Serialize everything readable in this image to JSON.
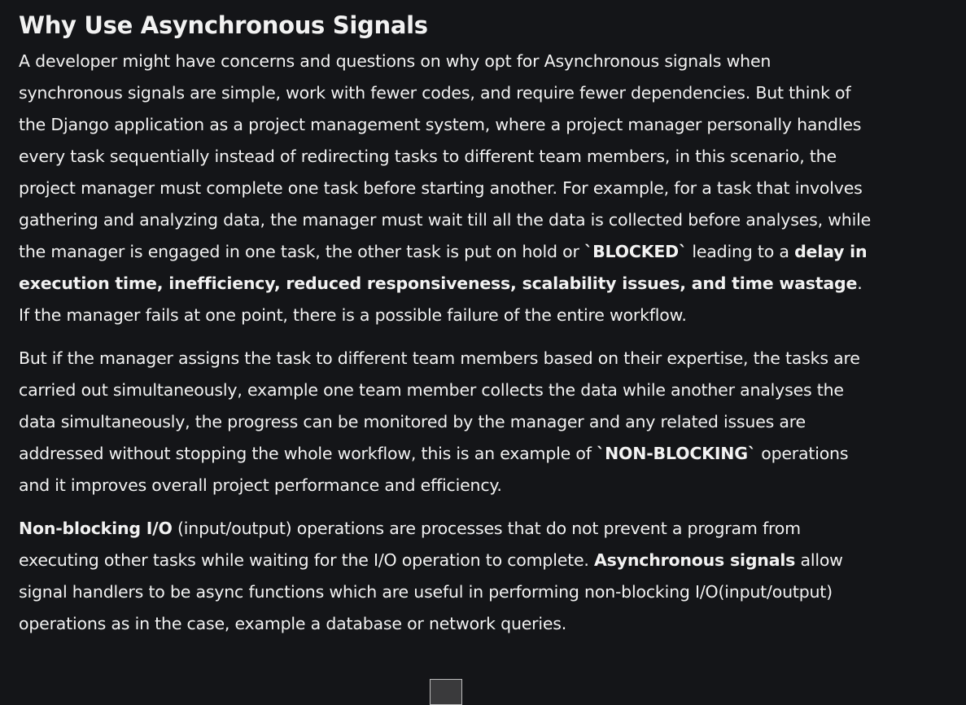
{
  "heading": "Why Use Asynchronous Signals",
  "p1": {
    "t1": "A developer might have concerns and questions on why opt for Asynchronous signals when synchronous signals are simple, work with fewer codes, and require fewer dependencies. But think of the Django application as a project management system, where a project manager personally handles every task sequentially instead of redirecting tasks to different team members, in this scenario, the project manager must complete one task before starting another. For example, for a task that involves gathering and analyzing data, the manager must wait till all the data is collected before analyses, while the manager is engaged in one task, the other task is put on hold or ",
    "b1": "`BLOCKED`",
    "t2": " leading to a ",
    "b2": "delay in execution time, inefficiency, reduced responsiveness, scalability issues, and time wastage",
    "t3": ". If the manager fails at one point, there is a possible failure of the entire workflow."
  },
  "p2": {
    "t1": "But if the manager assigns the task to different team members based on their expertise, the tasks are carried out simultaneously, example one team member collects the data while another analyses the data simultaneously, the progress can be monitored by the manager and any related issues are addressed without stopping the whole workflow, this is an example of ",
    "b1": "`NON-BLOCKING`",
    "t2": " operations and it improves overall project performance and efficiency."
  },
  "p3": {
    "b1": "Non-blocking I/O",
    "t1": " (input/output) operations are processes that do not prevent a program from executing other tasks while waiting for the I/O operation to complete. ",
    "b2": "Asynchronous signals",
    "t2": " allow signal handlers to be async functions which are useful in performing non-blocking I/O(input/output) operations as in the case, example a database or network queries."
  }
}
